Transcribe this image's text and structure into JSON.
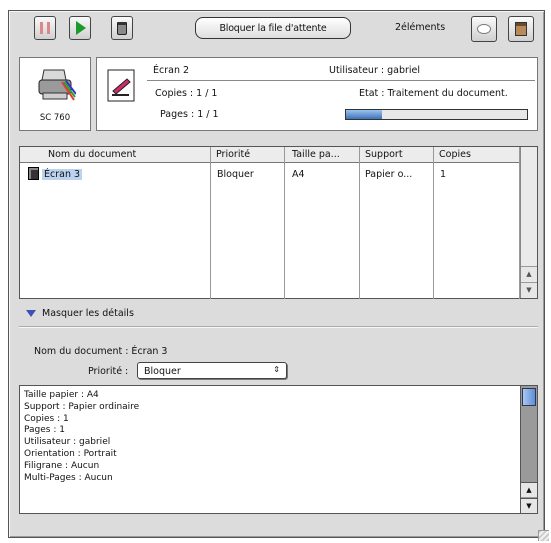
{
  "toolbar": {
    "hold_button_label": "Bloquer la file d'attente",
    "element_count": "2éléments"
  },
  "printer": {
    "name": "SC 760"
  },
  "current_job": {
    "name": "Écran 2",
    "user": "Utilisateur : gabriel",
    "copies": "Copies : 1 / 1",
    "status": "Etat : Traitement du document.",
    "pages": "Pages : 1 / 1",
    "progress": 0.2
  },
  "queue": {
    "columns": [
      "Nom du document",
      "Priorité",
      "Taille pa...",
      "Support",
      "Copies"
    ],
    "rows": [
      {
        "name": "Écran 3",
        "priority": "Bloquer",
        "paper_size": "A4",
        "support": "Papier o...",
        "copies": "1"
      }
    ]
  },
  "details": {
    "toggle_label": "Masquer les détails",
    "document_name_line": "Nom du document : Écran 3",
    "priority_label": "Priorité :",
    "priority_value": "Bloquer",
    "lines": [
      "Taille papier : A4",
      "Support : Papier ordinaire",
      "Copies : 1",
      "Pages : 1",
      "Utilisateur : gabriel",
      "Orientation : Portrait",
      "Filigrane : Aucun",
      "Multi-Pages : Aucun"
    ]
  }
}
